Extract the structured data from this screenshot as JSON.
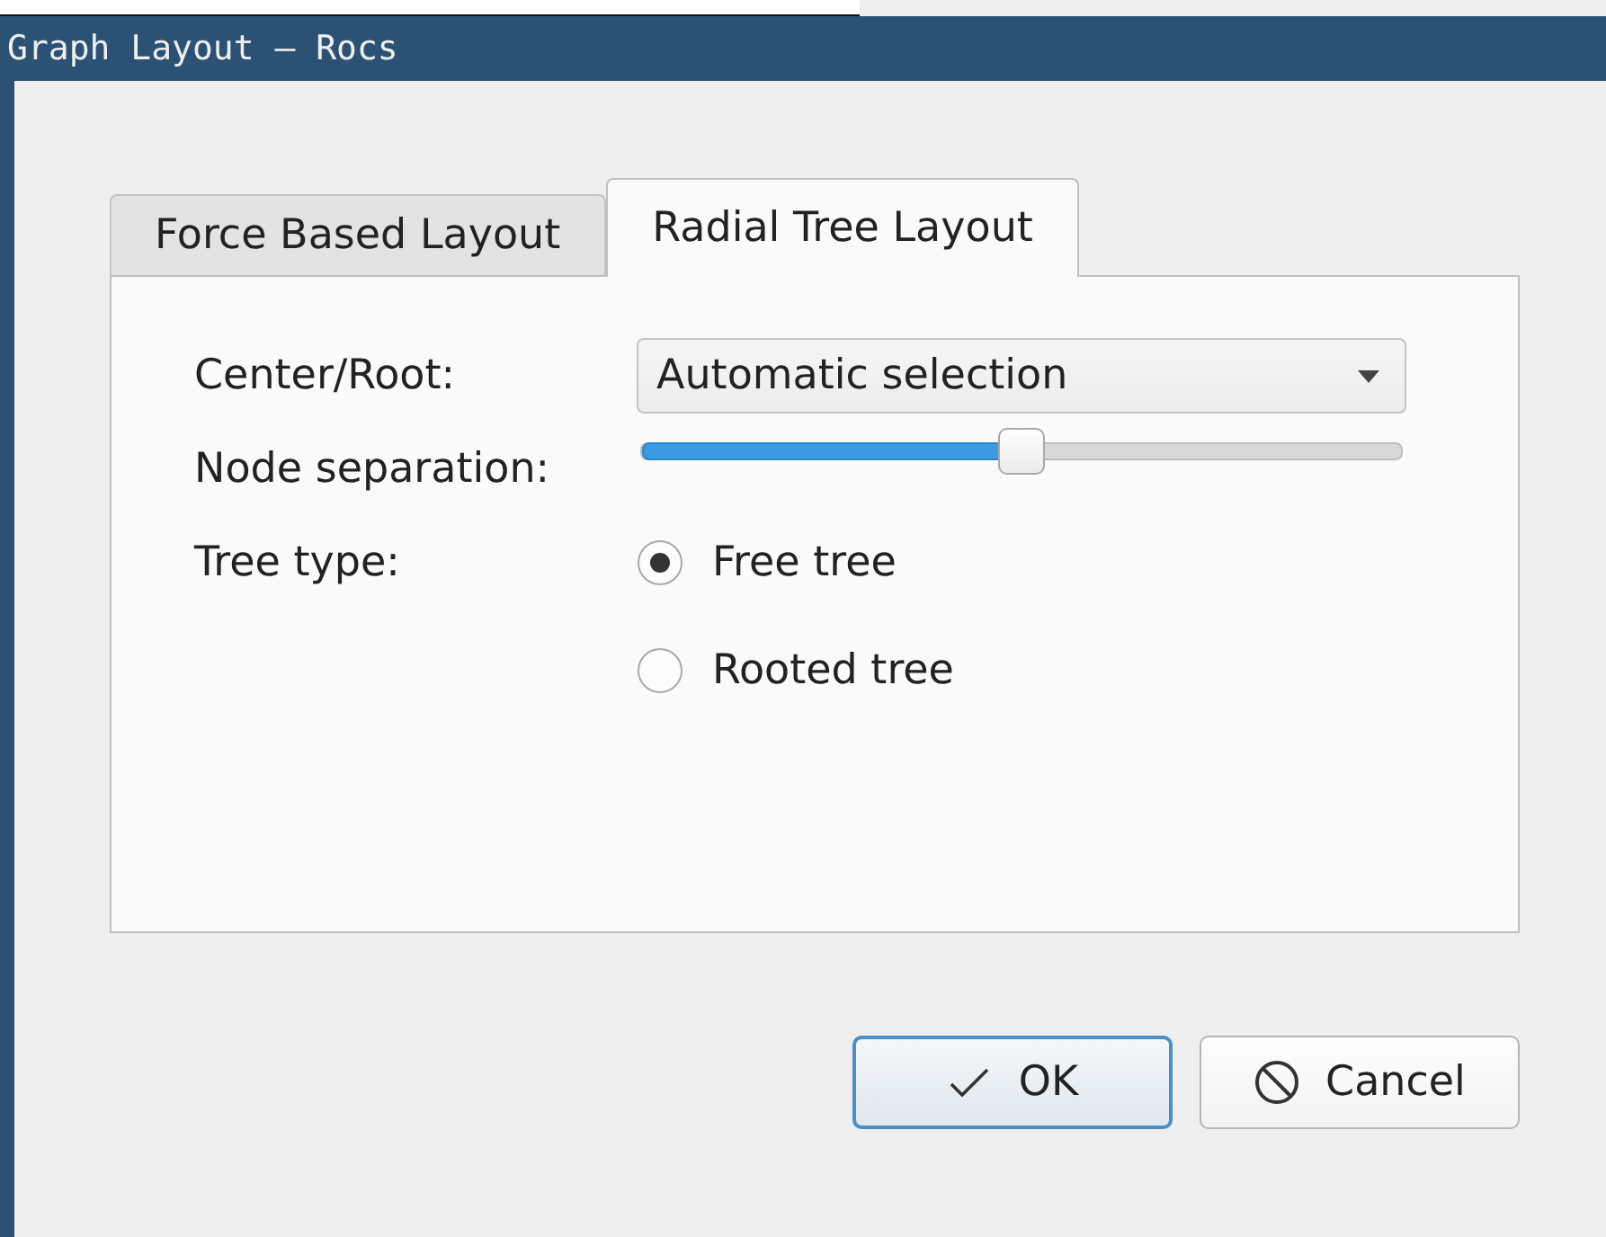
{
  "window": {
    "title": "Graph Layout — Rocs"
  },
  "tabs": [
    {
      "label": "Force Based Layout",
      "selected": false
    },
    {
      "label": "Radial Tree Layout",
      "selected": true
    }
  ],
  "form": {
    "center_label": "Center/Root:",
    "center_value": "Automatic selection",
    "separation_label": "Node separation:",
    "separation_slider": {
      "level": 0.5
    },
    "tree_type_label": "Tree type:",
    "tree_types": [
      {
        "label": "Free tree",
        "selected": true
      },
      {
        "label": "Rooted tree",
        "selected": false
      }
    ]
  },
  "buttons": [
    {
      "label": "OK",
      "kind": "ok"
    },
    {
      "label": "Cancel",
      "kind": "cancel"
    }
  ]
}
